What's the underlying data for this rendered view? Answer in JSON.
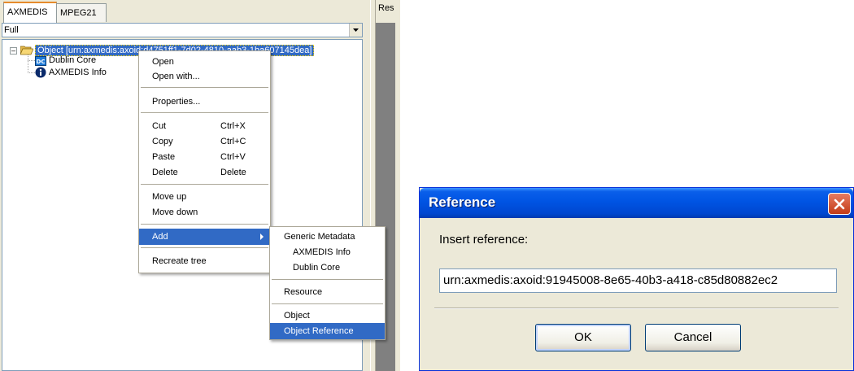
{
  "tabs": [
    {
      "label": "AXMEDIS"
    },
    {
      "label": "MPEG21"
    }
  ],
  "view_select": {
    "value": "Full"
  },
  "tree": {
    "root": {
      "label": "Object [urn:axmedis:axoid:d4751ff1-7d02-4810-aab3-1ba607145dea]"
    },
    "children": [
      {
        "label": "Dublin Core"
      },
      {
        "label": "AXMEDIS Info"
      }
    ]
  },
  "right_pane": {
    "tab_label": "Res"
  },
  "context_menu": {
    "items": [
      {
        "label": "Open"
      },
      {
        "label": "Open with..."
      },
      {
        "label": "Properties..."
      },
      {
        "label": "Cut",
        "shortcut": "Ctrl+X"
      },
      {
        "label": "Copy",
        "shortcut": "Ctrl+C"
      },
      {
        "label": "Paste",
        "shortcut": "Ctrl+V"
      },
      {
        "label": "Delete",
        "shortcut": "Delete"
      },
      {
        "label": "Move up"
      },
      {
        "label": "Move down"
      },
      {
        "label": "Add"
      },
      {
        "label": "Recreate tree"
      }
    ]
  },
  "add_submenu": {
    "items": [
      {
        "label": "Generic Metadata"
      },
      {
        "label": "AXMEDIS Info"
      },
      {
        "label": "Dublin Core"
      },
      {
        "label": "Resource"
      },
      {
        "label": "Object"
      },
      {
        "label": "Object Reference"
      }
    ]
  },
  "dialog": {
    "title": "Reference",
    "prompt": "Insert reference:",
    "input_value": "urn:axmedis:axoid:91945008-8e65-40b3-a418-c85d80882ec2",
    "ok_label": "OK",
    "cancel_label": "Cancel"
  },
  "colors": {
    "selection": "#316ac5",
    "titlebar": "#0054e3",
    "close_button": "#c23b16",
    "window_face": "#ece9d8"
  }
}
